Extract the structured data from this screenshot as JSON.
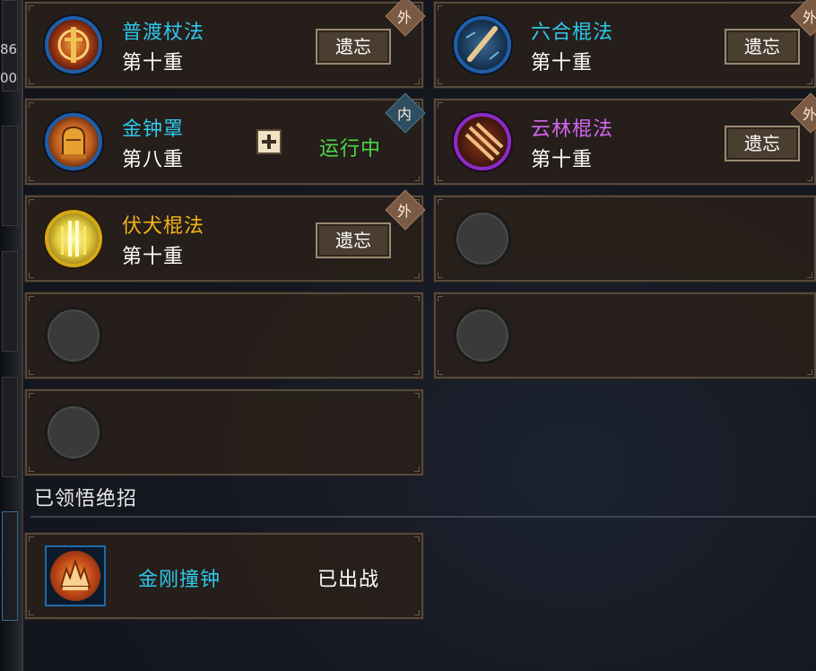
{
  "left_rail": {
    "numbers": [
      "86",
      "00"
    ]
  },
  "skills": [
    {
      "name": "普渡杖法",
      "level": "第十重",
      "button": "遗忘",
      "tag": "外",
      "name_color": "#2ec8ec",
      "icon": "staff-emblem-icon"
    },
    {
      "name": "六合棍法",
      "level": "第十重",
      "button": "遗忘",
      "tag": "外",
      "name_color": "#2ec8ec",
      "icon": "staff-strike-icon"
    },
    {
      "name": "金钟罩",
      "level": "第八重",
      "status": "运行中",
      "tag": "内",
      "name_color": "#2ec8ec",
      "status_color": "#4cd64a",
      "icon": "golden-bell-icon"
    },
    {
      "name": "云林棍法",
      "level": "第十重",
      "button": "遗忘",
      "tag": "外",
      "name_color": "#d467f0",
      "icon": "triple-slash-icon"
    },
    {
      "name": "伏犬棍法",
      "level": "第十重",
      "button": "遗忘",
      "tag": "外",
      "name_color": "#f2b418",
      "icon": "golden-pillar-icon"
    }
  ],
  "section": {
    "title": "已领悟绝招"
  },
  "ultimate": {
    "name": "金刚撞钟",
    "status": "已出战",
    "name_color": "#2ec8ec",
    "icon": "flame-bell-icon"
  }
}
